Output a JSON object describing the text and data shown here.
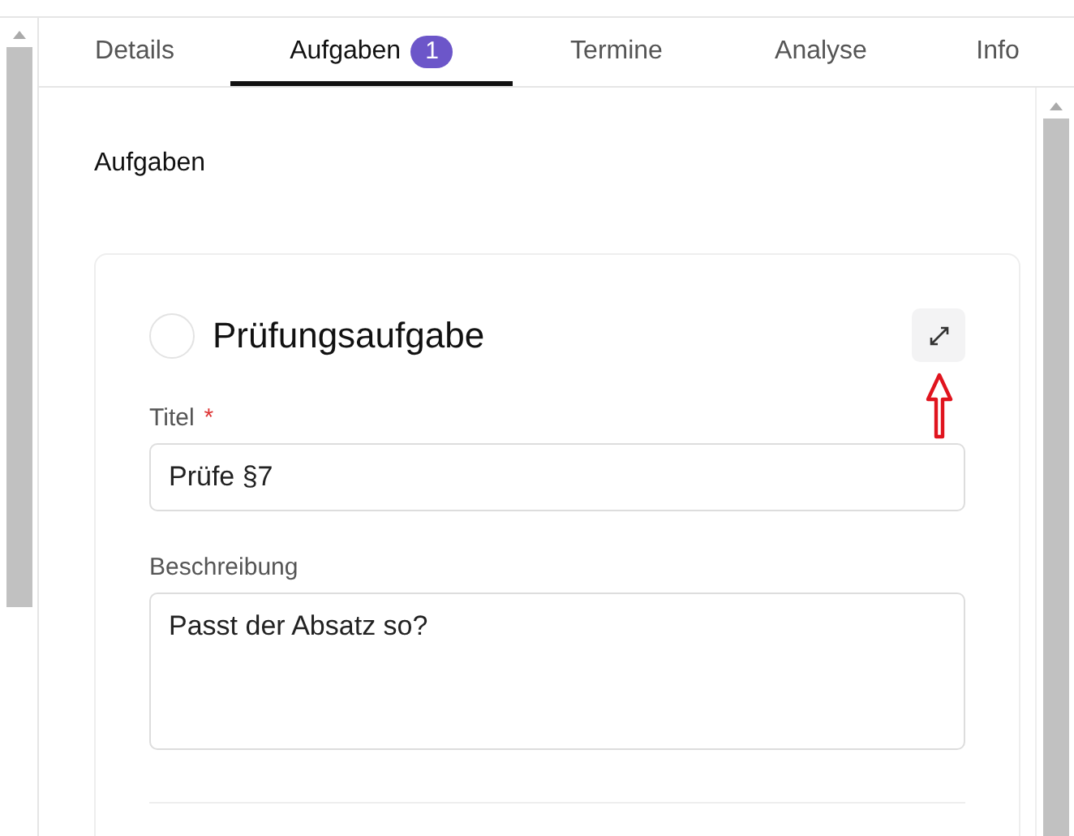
{
  "tabs": [
    {
      "label": "Details",
      "selected": false
    },
    {
      "label": "Aufgaben",
      "selected": true,
      "badge": "1"
    },
    {
      "label": "Termine",
      "selected": false
    },
    {
      "label": "Analyse",
      "selected": false
    },
    {
      "label": "Info",
      "selected": false
    }
  ],
  "section_title": "Aufgaben",
  "task": {
    "title": "Prüfungsaufgabe",
    "checked": false,
    "annotated": true,
    "fields": [
      {
        "kind": "input",
        "label": "Titel",
        "required_mark": "*",
        "value": "Prüfe §7"
      },
      {
        "kind": "textarea",
        "label": "Beschreibung",
        "value": "Passt der Absatz so?"
      }
    ]
  }
}
